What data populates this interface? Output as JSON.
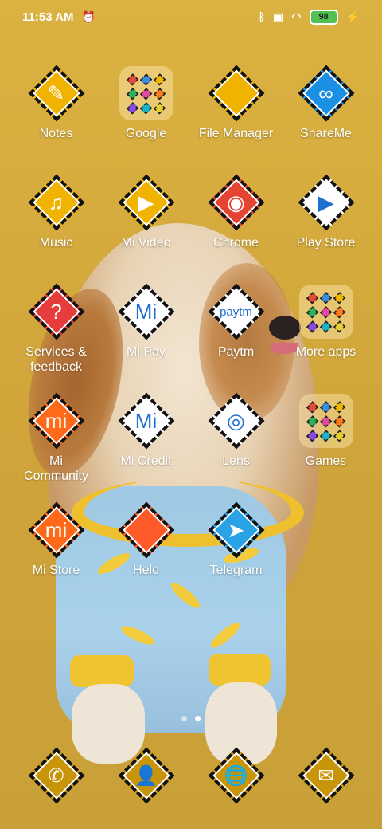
{
  "status_bar": {
    "time": "11:53 AM",
    "battery": "98",
    "icons": [
      "alarm-off-icon",
      "bluetooth-icon",
      "sim-off-icon",
      "wifi-icon",
      "battery-icon",
      "charging-icon"
    ]
  },
  "apps": [
    {
      "label": "Notes",
      "icon": "notes-icon",
      "color": "#f0b400",
      "glyph": "✎"
    },
    {
      "label": "Google",
      "icon": "google-folder-icon",
      "type": "folder"
    },
    {
      "label": "File Manager",
      "icon": "file-manager-icon",
      "color": "#f0b400",
      "glyph": ""
    },
    {
      "label": "ShareMe",
      "icon": "shareme-icon",
      "color": "#1a8fe3",
      "glyph": "∞"
    },
    {
      "label": "Music",
      "icon": "music-icon",
      "color": "#f0b400",
      "glyph": "♫"
    },
    {
      "label": "Mi Video",
      "icon": "mi-video-icon",
      "color": "#f0b400",
      "glyph": "▶"
    },
    {
      "label": "Chrome",
      "icon": "chrome-icon",
      "color": "#e64433",
      "glyph": "◉"
    },
    {
      "label": "Play Store",
      "icon": "play-store-icon",
      "color": "#ffffff",
      "glyph": "▶"
    },
    {
      "label": "Services &\nfeedback",
      "icon": "services-feedback-icon",
      "color": "#e63c3c",
      "glyph": "?"
    },
    {
      "label": "Mi Pay",
      "icon": "mi-pay-icon",
      "color": "#ffffff",
      "glyph": "Mi"
    },
    {
      "label": "Paytm",
      "icon": "paytm-icon",
      "color": "#ffffff",
      "glyph": "paytm"
    },
    {
      "label": "More apps",
      "icon": "more-apps-folder-icon",
      "type": "folder"
    },
    {
      "label": "Mi\nCommunity",
      "icon": "mi-community-icon",
      "color": "#ff6a1a",
      "glyph": "mi"
    },
    {
      "label": "Mi Credit",
      "icon": "mi-credit-icon",
      "color": "#ffffff",
      "glyph": "Mi"
    },
    {
      "label": "Lens",
      "icon": "lens-icon",
      "color": "#ffffff",
      "glyph": "◎"
    },
    {
      "label": "Games",
      "icon": "games-folder-icon",
      "type": "folder"
    },
    {
      "label": "Mi Store",
      "icon": "mi-store-icon",
      "color": "#ff6a1a",
      "glyph": "mi"
    },
    {
      "label": "Helo",
      "icon": "helo-icon",
      "color": "#ff5a2a",
      "glyph": ""
    },
    {
      "label": "Telegram",
      "icon": "telegram-icon",
      "color": "#2aa3e6",
      "glyph": "➤"
    }
  ],
  "page_indicator": {
    "total": 2,
    "active": 2
  },
  "dock": [
    {
      "icon": "phone-icon",
      "glyph": "✆"
    },
    {
      "icon": "contacts-icon",
      "glyph": "👤"
    },
    {
      "icon": "browser-icon",
      "glyph": "🌐"
    },
    {
      "icon": "messages-icon",
      "glyph": "✉"
    }
  ]
}
